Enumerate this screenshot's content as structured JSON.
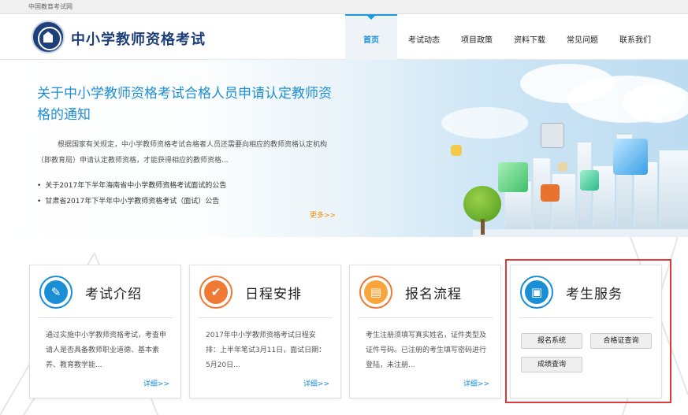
{
  "topbar": {
    "site_name": "中国教育考试网"
  },
  "header": {
    "title": "中小学教师资格考试",
    "nav": [
      {
        "label": "首页",
        "active": true
      },
      {
        "label": "考试动态"
      },
      {
        "label": "项目政策"
      },
      {
        "label": "资料下载"
      },
      {
        "label": "常见问题"
      },
      {
        "label": "联系我们"
      }
    ]
  },
  "banner": {
    "title": "关于中小学教师资格考试合格人员申请认定教师资格的通知",
    "description": "根据国家有关规定，中小学教师资格考试合格者人员还需要向相应的教师资格认定机构（即教育局）申请认定教师资格，才能获得相应的教师资格...",
    "news": [
      "关于2017年下半年海南省中小学教师资格考试面试的公告",
      "甘肃省2017年下半年中小学教师资格考试（面试）公告"
    ],
    "more": "更多>>"
  },
  "cards": [
    {
      "title": "考试介绍",
      "icon": "document-edit-icon",
      "text": "通过实施中小学教师资格考试，考查申请人是否具备教师职业道德、基本素养、教育教学能...",
      "more": "详细>>"
    },
    {
      "title": "日程安排",
      "icon": "checkmark-icon",
      "text": "2017年中小学教师资格考试日程安排：上半年笔试3月11日，面试日期：5月20日...",
      "more": "详细>>"
    },
    {
      "title": "报名流程",
      "icon": "registration-form-icon",
      "text": "考生注册须填写真实姓名，证件类型及证件号码。已注册的考生填写密码进行登陆，未注册...",
      "more": "详细>>"
    }
  ],
  "service": {
    "title": "考生服务",
    "icon": "address-book-icon",
    "buttons": [
      "报名系统",
      "合格证查询",
      "成绩查询"
    ]
  },
  "colors": {
    "primary": "#1a8fd6",
    "accent": "#f07a35",
    "highlight": "#e23a3a",
    "more_orange": "#f39000"
  }
}
